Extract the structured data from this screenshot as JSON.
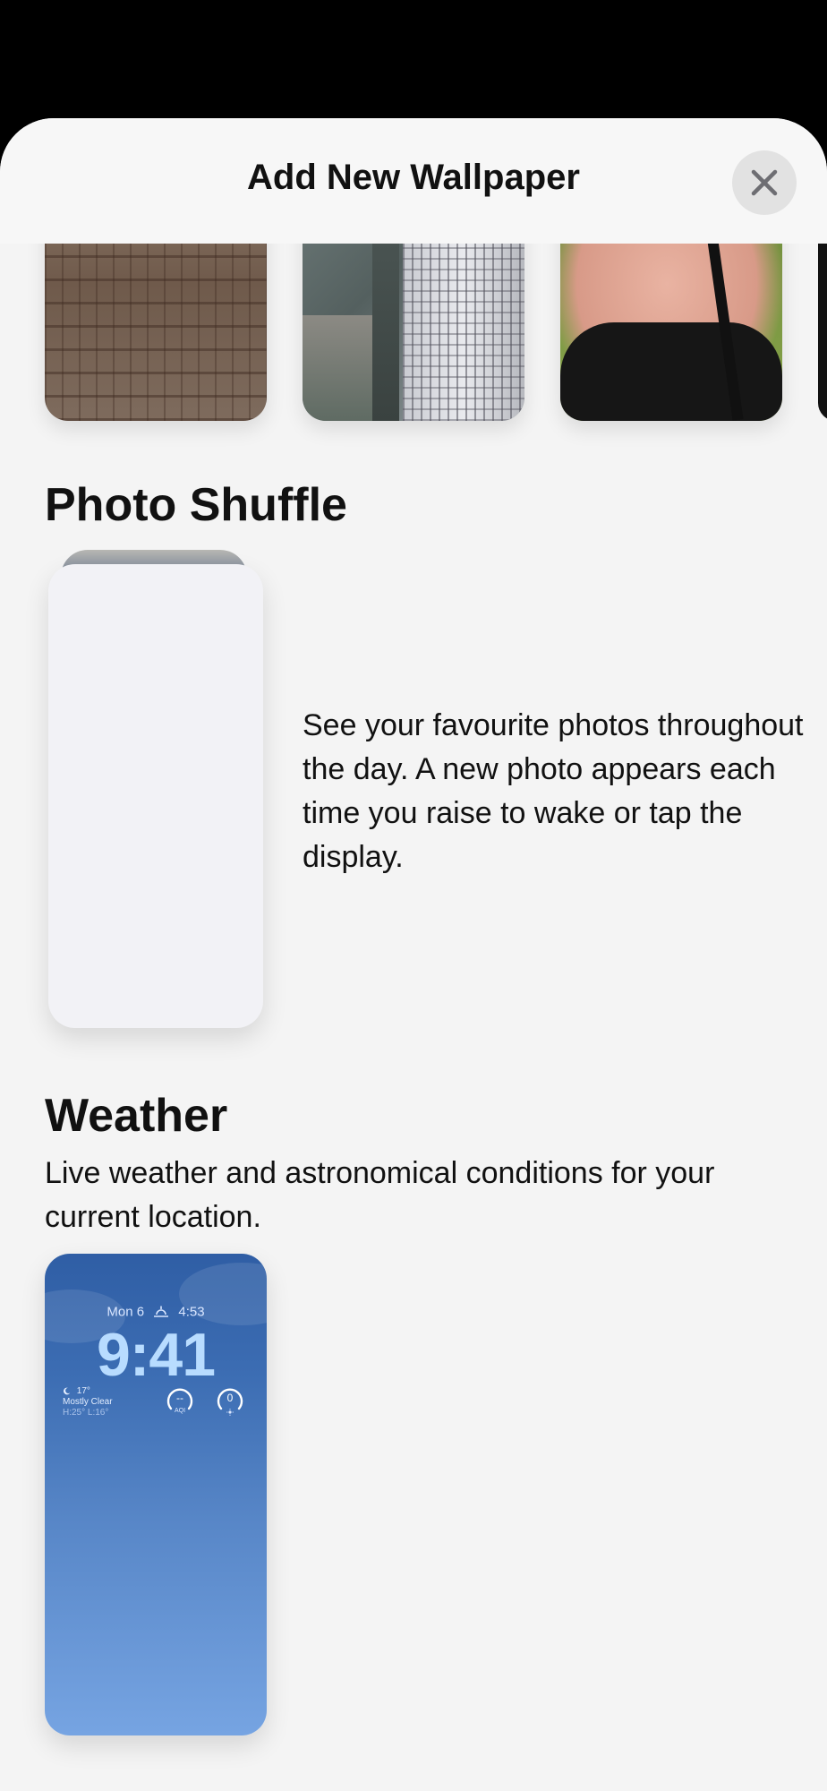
{
  "sheet": {
    "title": "Add New Wallpaper",
    "close_icon": "xmark-icon"
  },
  "photos_row": {
    "items": [
      "wooden deck photo",
      "city aerial photo",
      "person photo"
    ]
  },
  "photo_shuffle": {
    "title": "Photo Shuffle",
    "description": "See your favourite photos throughout the day. A new photo appears each time you raise to wake or tap the display."
  },
  "weather": {
    "title": "Weather",
    "description": "Live weather and astronomical conditions for your current location.",
    "preview": {
      "date": "Mon 6",
      "sunrise_time": "4:53",
      "time": "9:41",
      "temperature": "17°",
      "condition": "Mostly Clear",
      "high_low": "H:25° L:16°",
      "aqi_value": "--",
      "aqi_label": "AQI",
      "uv_value": "0"
    }
  },
  "colors": {
    "sheet_background": "#f4f4f4",
    "weather_gradient_top": "#2f5ea5",
    "weather_gradient_bottom": "#76a4e2",
    "time_color": "#b8dcff"
  }
}
